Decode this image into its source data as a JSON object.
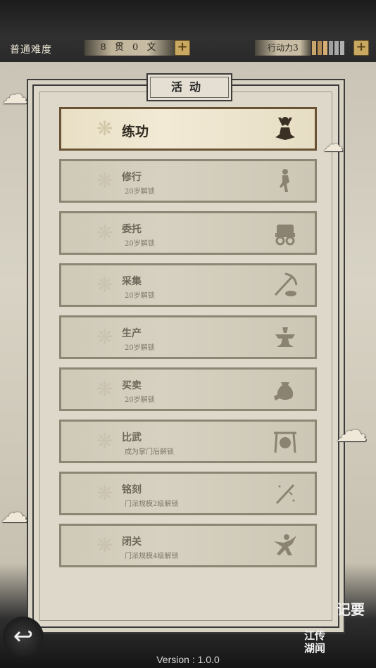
{
  "header": {
    "difficulty": "普通难度",
    "money": "8 贯 0 文",
    "action_power": "行动力3",
    "action_bars": [
      "#c9a66b",
      "#b48d55",
      "#d6ae74",
      "#9f9f9f",
      "#a9a9a9",
      "#b0b0b0"
    ],
    "plus_symbol": "+"
  },
  "panel": {
    "title": "活动"
  },
  "activities": [
    {
      "name": "练功",
      "sub": "",
      "icon": "meditation-icon"
    },
    {
      "name": "修行",
      "sub": "20岁解锁",
      "icon": "training-icon"
    },
    {
      "name": "委托",
      "sub": "20岁解锁",
      "icon": "cart-icon"
    },
    {
      "name": "采集",
      "sub": "20岁解锁",
      "icon": "pickaxe-icon"
    },
    {
      "name": "生产",
      "sub": "20岁解锁",
      "icon": "anvil-icon"
    },
    {
      "name": "买卖",
      "sub": "20岁解锁",
      "icon": "money-bag-icon"
    },
    {
      "name": "比武",
      "sub": "成为掌门后解锁",
      "icon": "gong-icon"
    },
    {
      "name": "铭刻",
      "sub": "门派规模2级解锁",
      "icon": "engraving-icon"
    },
    {
      "name": "闭关",
      "sub": "门派规模4级解锁",
      "icon": "martial-pose-icon"
    }
  ],
  "footer": {
    "back_symbol": "↩",
    "notes": "记要",
    "jianghu": "江传",
    "jianghu2": "湖闻",
    "version": "Version : 1.0.0"
  },
  "colors": {
    "accent": "#c9a961",
    "active_border": "#6a5334"
  }
}
